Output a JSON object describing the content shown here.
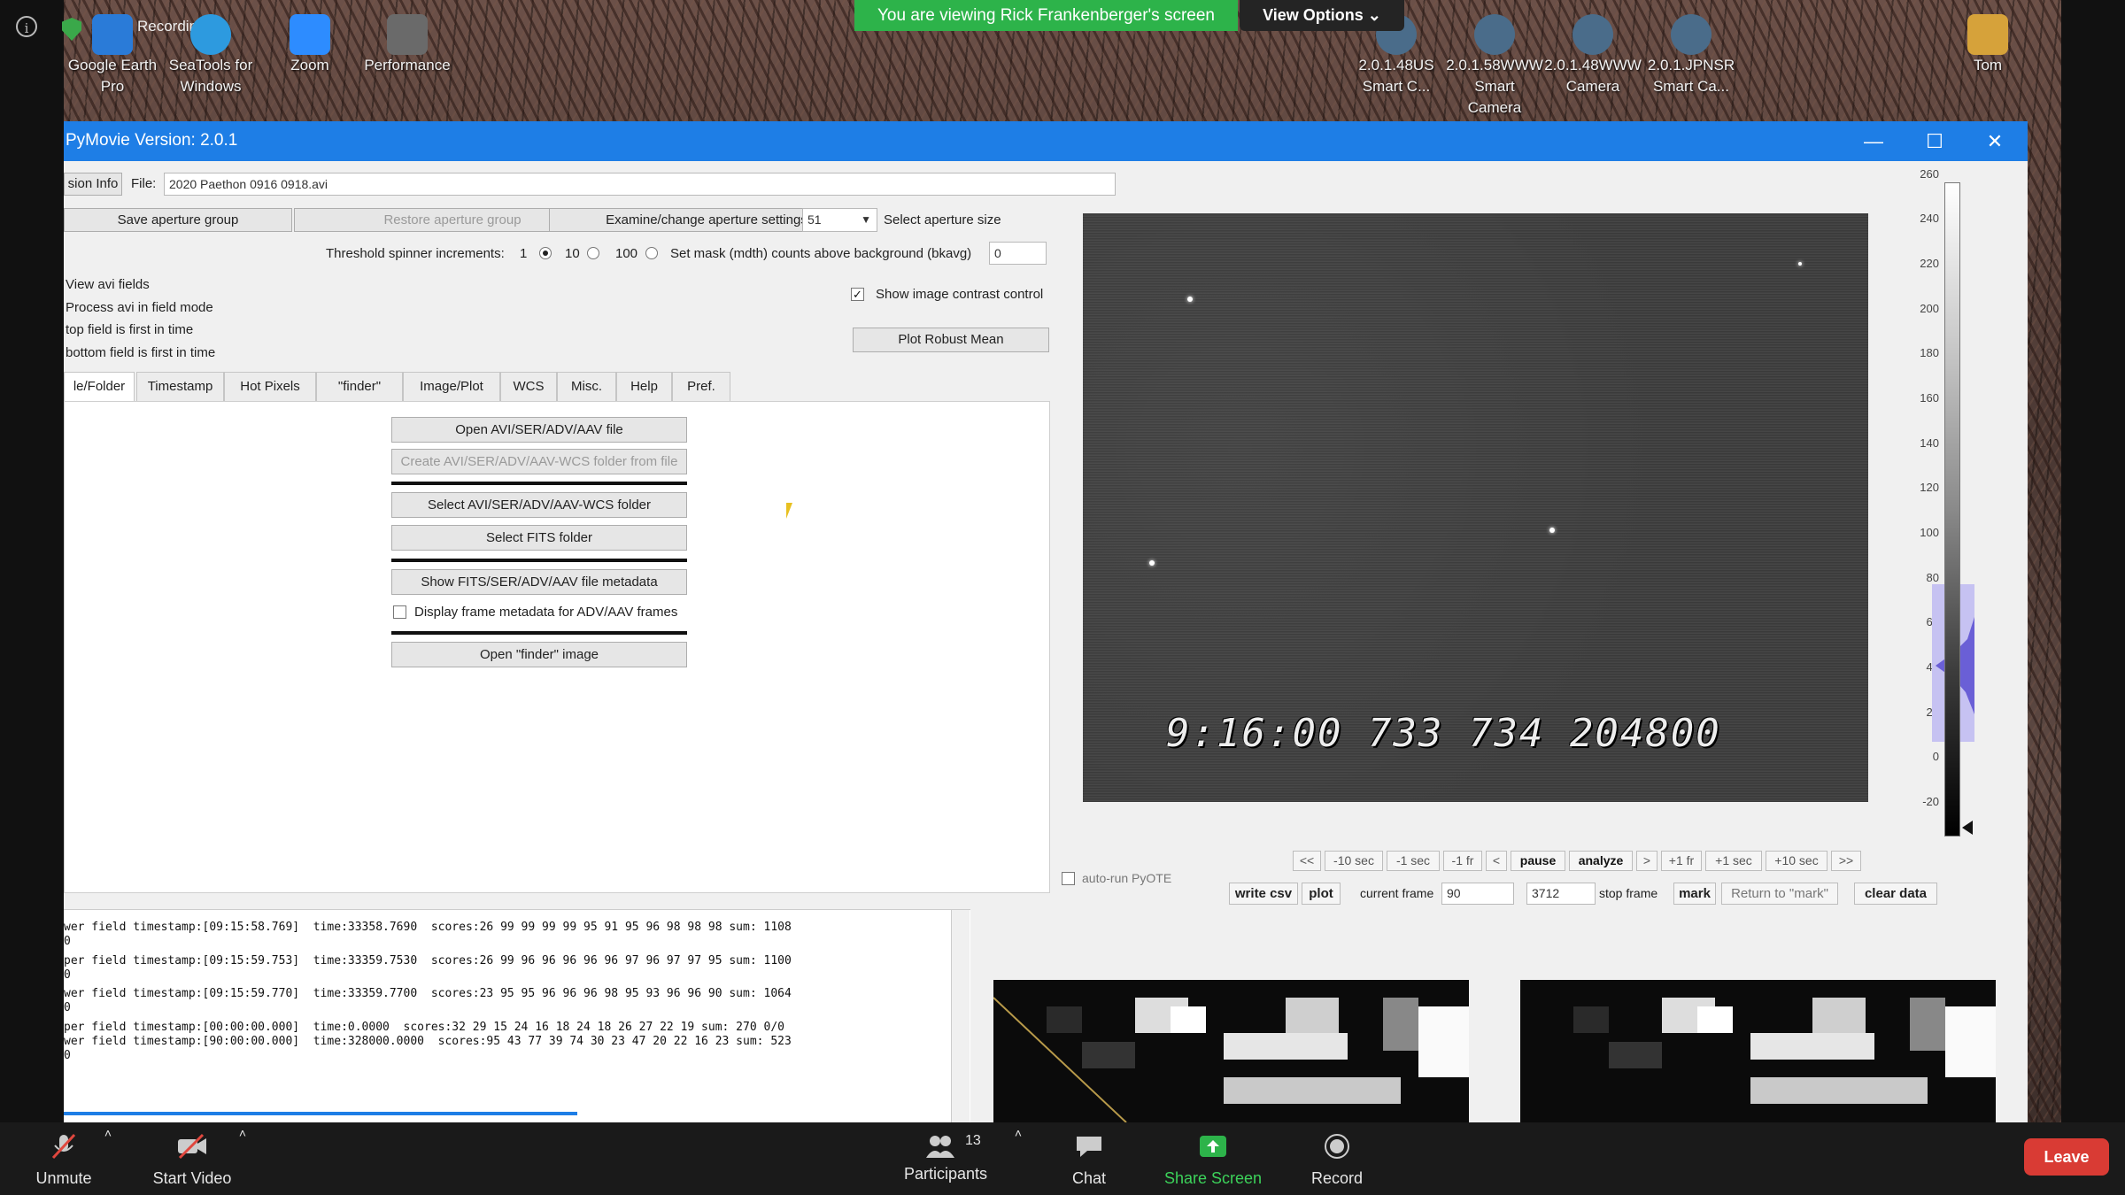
{
  "desktop": {
    "recording_label": "Recording",
    "icons": [
      {
        "label": "Google Earth Pro",
        "color": "#2a7bd8"
      },
      {
        "label": "SeaTools for Windows",
        "color": "#2d9adf"
      },
      {
        "label": "Zoom",
        "color": "#2d8cff"
      },
      {
        "label": "Performance",
        "color": "#6a6a6a"
      },
      {
        "label": "2.0.1.48US Smart C...",
        "color": "#4a6c8a"
      },
      {
        "label": "2.0.1.58WWW Smart Camera",
        "color": "#4a6c8a"
      },
      {
        "label": "2.0.1.48WWW Camera",
        "color": "#4a6c8a"
      },
      {
        "label": "2.0.1.JPNSR Smart Ca...",
        "color": "#4a6c8a"
      },
      {
        "label": "Tom",
        "color": "#d6a23a"
      }
    ]
  },
  "zoom_share": {
    "banner": "You are viewing Rick Frankenberger's screen",
    "view_options": "View Options ⌄"
  },
  "window": {
    "title": "PyMovie  Version: 2.0.1",
    "minimize": "—",
    "maximize": "☐",
    "close": "✕"
  },
  "top_controls": {
    "version_info_btn": "sion Info",
    "file_label": "File:",
    "file_value": "2020 Paethon 0916 0918.avi",
    "save_aperture_group": "Save aperture group",
    "restore_aperture_group": "Restore aperture group",
    "examine_aperture_settings": "Examine/change aperture settings",
    "aperture_size_value": "51",
    "select_aperture_size": "Select aperture size",
    "threshold_label": "Threshold spinner increments:",
    "inc_1": "1",
    "inc_10": "10",
    "inc_100": "100",
    "set_mask_label": "Set mask (mdth) counts above background (bkavg)",
    "mask_value": "0",
    "field_options": [
      "View avi fields",
      "Process avi in field mode",
      "top field is first in time",
      "bottom field is first in time"
    ],
    "show_contrast_label": "Show image contrast control",
    "plot_robust_mean": "Plot Robust Mean"
  },
  "tabs": [
    "le/Folder",
    "Timestamp",
    "Hot Pixels",
    "\"finder\"",
    "Image/Plot",
    "WCS",
    "Misc.",
    "Help",
    "Pref."
  ],
  "file_panel": {
    "open_file": "Open AVI/SER/ADV/AAV file",
    "create_wcs_folder": "Create AVI/SER/ADV/AAV-WCS folder from file",
    "select_wcs_folder": "Select AVI/SER/ADV/AAV-WCS folder",
    "select_fits_folder": "Select FITS folder",
    "show_metadata": "Show FITS/SER/ADV/AAV file metadata",
    "display_frame_metadata": "Display frame metadata for ADV/AAV frames",
    "open_finder": "Open \"finder\" image"
  },
  "video": {
    "timestamp_overlay": "9:16:00   733   734 204800"
  },
  "histogram": {
    "ticks": [
      "260",
      "240",
      "220",
      "200",
      "180",
      "160",
      "140",
      "120",
      "100",
      "80",
      "60",
      "40",
      "20",
      "0",
      "-20"
    ]
  },
  "playback": {
    "buttons": [
      "<<",
      "-10 sec",
      "-1 sec",
      "-1 fr",
      "<",
      "pause",
      "analyze",
      ">",
      "+1 fr",
      "+1 sec",
      "+10 sec",
      ">>"
    ],
    "auto_run_pyote": "auto-run PyOTE",
    "write_csv": "write csv",
    "plot": "plot",
    "current_frame_label": "current frame",
    "current_frame_value": "90",
    "stop_frame_value": "3712",
    "stop_frame_label": "stop frame",
    "mark": "mark",
    "return_to_mark": "Return to \"mark\"",
    "clear_data": "clear data"
  },
  "log": [
    "wer field timestamp:[09:15:58.769]  time:33358.7690  scores:26 99 99 99 99 95 91 95 96 98 98 98 sum: 1108",
    "0",
    "per field timestamp:[09:15:59.753]  time:33359.7530  scores:26 99 96 96 96 96 96 97 96 97 97 95 sum: 1100",
    "0",
    "wer field timestamp:[09:15:59.770]  time:33359.7700  scores:23 95 95 96 96 96 98 95 93 96 96 90 sum: 1064",
    "0",
    "per field timestamp:[00:00:00.000]  time:0.0000  scores:32 29 15 24 16 18 24 18 26 27 22 19 sum: 270 0/0",
    "wer field timestamp:[90:00:00.000]  time:328000.0000  scores:95 43 77 39 74 30 23 47 20 22 16 23 sum: 523",
    "0"
  ],
  "zoom_toolbar": {
    "unmute": "Unmute",
    "start_video": "Start Video",
    "participants": "Participants",
    "participant_count": "13",
    "chat": "Chat",
    "share_screen": "Share Screen",
    "record": "Record",
    "leave": "Leave"
  },
  "colors": {
    "zoom_green": "#2db34a",
    "titlebar_blue": "#1e7ee6",
    "leave_red": "#d93b34"
  }
}
